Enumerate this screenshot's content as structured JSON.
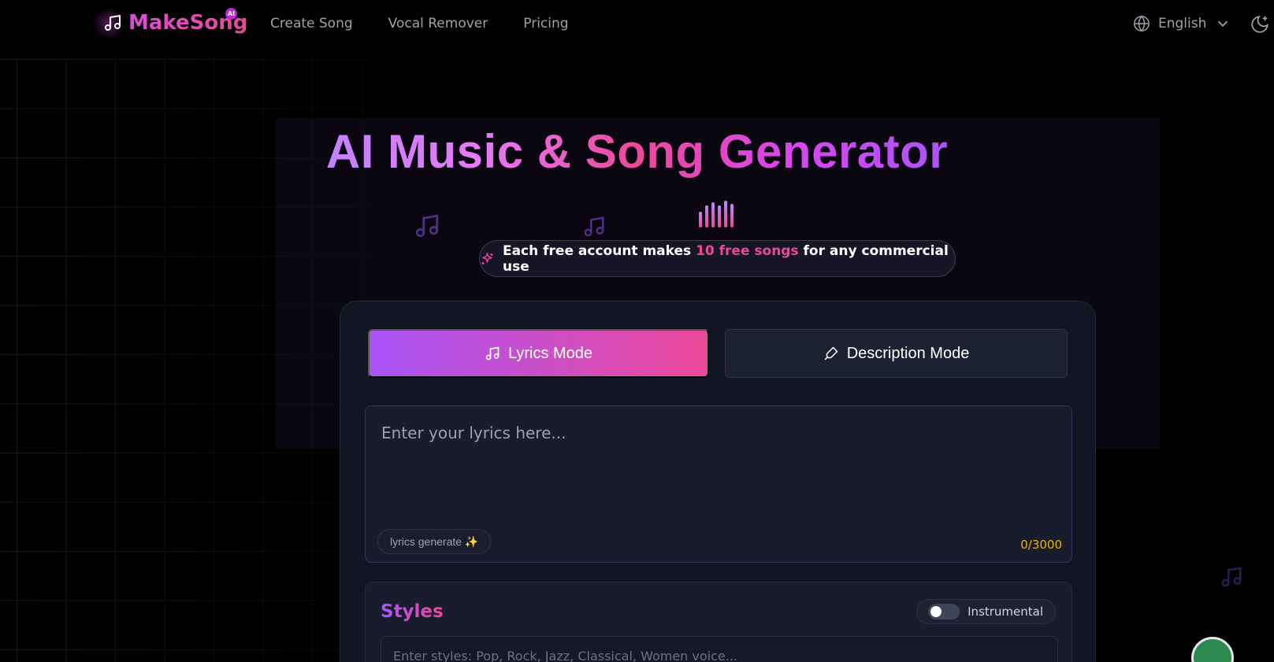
{
  "brand": {
    "name": "MakeSong",
    "badge": "AI"
  },
  "nav": {
    "items": [
      "Create Song",
      "Vocal Remover",
      "Pricing"
    ]
  },
  "language": {
    "selected": "English"
  },
  "hero": {
    "title": "AI Music & Song Generator",
    "promo_prefix": "Each free account makes ",
    "promo_highlight": "10 free songs",
    "promo_suffix": " for any commercial use"
  },
  "modes": {
    "lyrics_label": "Lyrics Mode",
    "description_label": "Description Mode",
    "active": "lyrics"
  },
  "lyrics": {
    "placeholder": "Enter your lyrics here...",
    "generate_label": "lyrics generate ✨",
    "counter": "0/3000"
  },
  "styles": {
    "title": "Styles",
    "instrumental_label": "Instrumental",
    "instrumental_on": false,
    "placeholder": "Enter styles: Pop, Rock, Jazz, Classical, Women voice..."
  },
  "colors": {
    "accent_purple": "#a855f7",
    "accent_pink": "#ec4899",
    "counter": "#eab308"
  }
}
